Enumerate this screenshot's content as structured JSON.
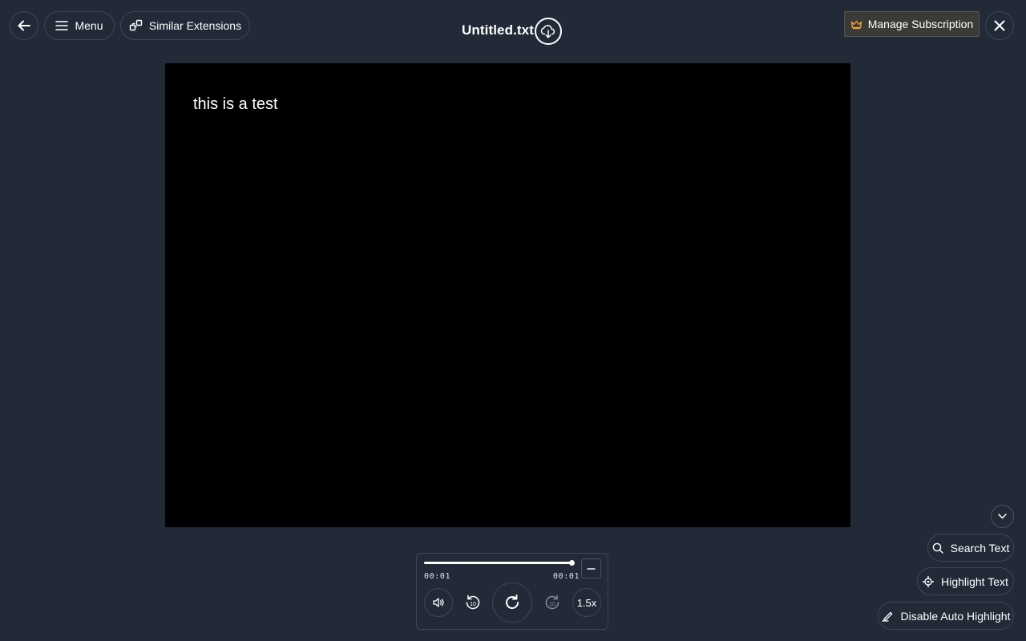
{
  "header": {
    "menu_label": "Menu",
    "similar_label": "Similar Extensions",
    "doc_title": "Untitled.txt",
    "manage_subscription_label": "Manage Subscription"
  },
  "document": {
    "text": "this is a test"
  },
  "player": {
    "progress": 1.0,
    "time_current": "00:01",
    "time_total": "00:01",
    "speed_label": "1.5x",
    "skip_seconds": "10"
  },
  "tools": {
    "search_label": "Search Text",
    "highlight_label": "Highlight Text",
    "disable_auto_label": "Disable Auto Highlight"
  },
  "icons": {
    "back": "arrow-left-icon",
    "menu": "hamburger-icon",
    "similar": "extensions-icon",
    "download": "cloud-download-icon",
    "crown": "crown-icon",
    "close": "close-icon",
    "volume": "speaker-icon",
    "rewind": "rewind-10-icon",
    "replay": "replay-icon",
    "forward": "forward-10-icon",
    "collapse": "minus-icon",
    "chevron": "chevron-down-icon",
    "search": "search-icon",
    "highlight": "target-icon",
    "pen": "pen-icon"
  },
  "colors": {
    "background": "#222a38",
    "viewer": "#000000",
    "crown": "#e8a33a",
    "border": "#3f4757"
  }
}
